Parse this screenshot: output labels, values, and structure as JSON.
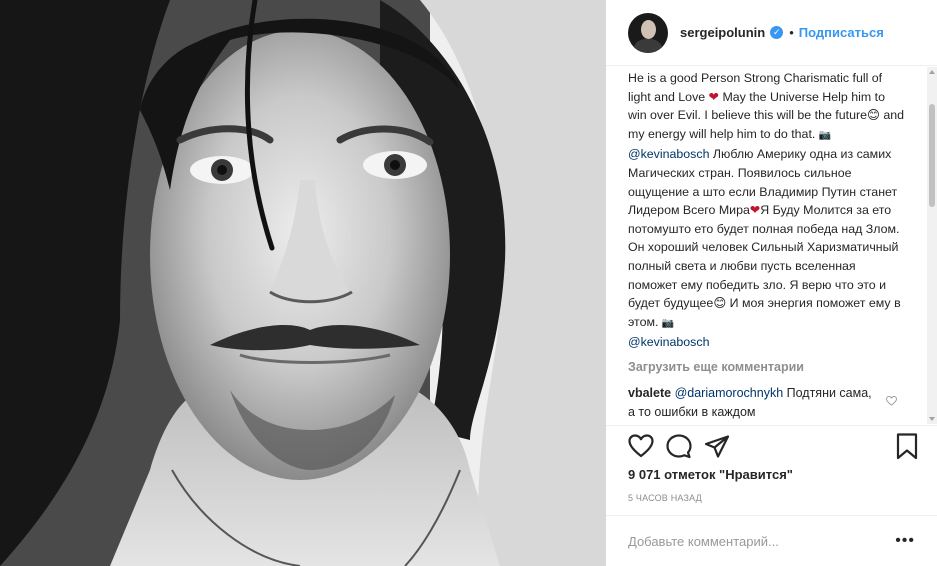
{
  "post": {
    "image_alt": "black and white portrait photo"
  },
  "header": {
    "username": "sergeipolunin",
    "verified_mark": "✓",
    "separator": "•",
    "follow_label": "Подписаться"
  },
  "caption": {
    "part1": "He is a good Person Strong Charismatic full of light and Love ",
    "heart": "❤",
    "part2": " May the Universe Help him to win over Evil. I believe this will be the future",
    "smile": "😊",
    "part3": " and my energy will help him to do that. ",
    "camera": "📷",
    "mention1": "@kevinabosch",
    "part4": " Люблю Америку одна из самих Магических стран. Появилось сильное ощущение а што если Владимир Путин станет Лидером Всего Мира",
    "heart2": "❤",
    "part5": "Я Буду Молится за ето потомушто ето будет полная победа над Злом. Он хороший человек Сильный Харизматичный полный света и любви пусть вселенная поможет ему победить зло. Я верю что это и будет будущее",
    "smile2": "😊",
    "part6": " И моя энергия поможет ему в этом. ",
    "camera2": "📷",
    "mention2": "@kevinabosch"
  },
  "load_more_label": "Загрузить еще комментарии",
  "comments": [
    {
      "user": "vbalete",
      "mention": "@dariamorochnykh",
      "text": " Подтяни сама, а то ошибки в каждом"
    }
  ],
  "likes_label": "9 071 отметок \"Нравится\"",
  "time_label": "5 часов назад",
  "add_comment": {
    "placeholder": "Добавьте комментарий...",
    "more_glyph": "•••"
  },
  "icons": {
    "like": "heart-icon",
    "comment": "comment-bubble-icon",
    "share": "share-icon",
    "save": "bookmark-icon",
    "more": "more-options-icon",
    "verified": "verified-badge-icon"
  },
  "colors": {
    "link": "#3897f0",
    "mention": "#003569",
    "muted": "#8e8e8e",
    "text": "#262626",
    "heart": "#c0152f"
  }
}
